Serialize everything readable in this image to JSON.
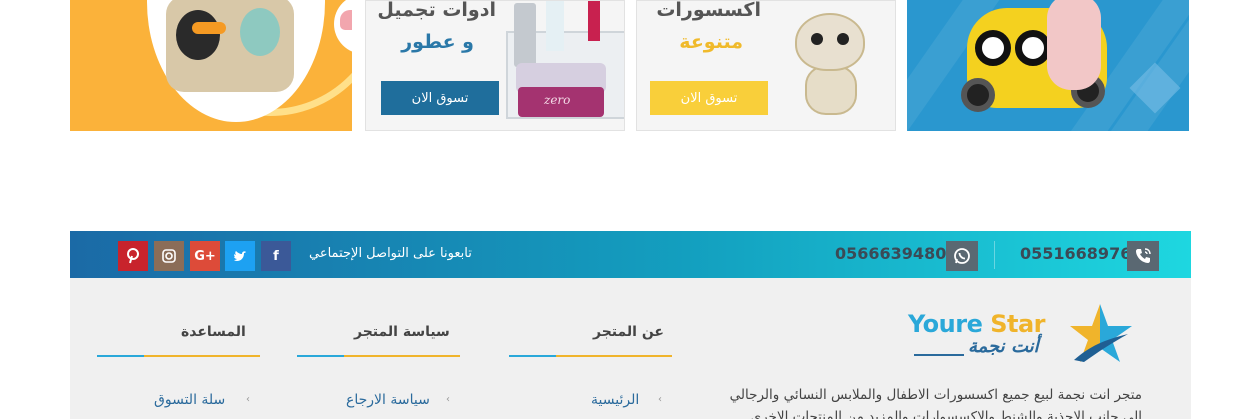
{
  "banners": {
    "cosmetics": {
      "title": "أدوات تجميل",
      "subtitle": "و عطور",
      "button": "تسوق الان",
      "button_color": "#1f6e9c",
      "subtitle_color": "#2a78a8"
    },
    "accessories": {
      "title": "أكسسورات",
      "subtitle": "متنوعة",
      "button": "تسوق الان",
      "button_color": "#f9cf3a",
      "subtitle_color": "#f0ba2b"
    },
    "bags": {
      "background": "#fbb23a"
    },
    "kids": {
      "background": "#2a97cf"
    },
    "cosmetics_jar_label": "zero"
  },
  "social_bar": {
    "follow_text": "تابعونا على التواصل الإجتماعي",
    "phone_whatsapp": "0566639480",
    "phone_call": "0551668976",
    "icons": [
      "pinterest-icon",
      "instagram-icon",
      "google-plus-icon",
      "twitter-icon",
      "facebook-icon"
    ],
    "glyphs": {
      "pinterest": "𝗽",
      "instagram": "◘",
      "google": "G+",
      "twitter": "🐦",
      "facebook": "f"
    }
  },
  "footer": {
    "logo": {
      "en_part1": "Youre ",
      "en_part2": "Star",
      "ar": "أنت نجمة"
    },
    "about": "متجر انت نجمة لبيع جميع اكسسورات الاطفال والملابس النسائي والرجالي الى جانب الاحذية والشنط والاكسسوارات والمزيد من المنتجات الاخرى",
    "columns": [
      {
        "title": "عن المتجر",
        "first_link": "الرئيسية"
      },
      {
        "title": "سياسة المتجر",
        "first_link": "سياسة الارجاع"
      },
      {
        "title": "المساعدة",
        "first_link": "سلة التسوق"
      }
    ],
    "colors": {
      "accent": "#f0b42b",
      "blue": "#2aa8d9",
      "link": "#2a6a9c"
    }
  }
}
